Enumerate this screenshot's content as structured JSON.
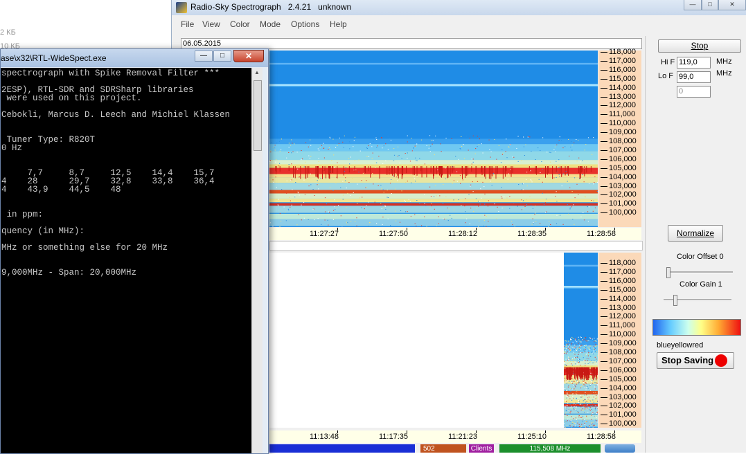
{
  "background": {
    "sizes": [
      "2 КБ",
      "10 КБ"
    ]
  },
  "app": {
    "title": "Radio-Sky Spectrograph",
    "version": "2.4.21",
    "status": "unknown"
  },
  "menu": [
    "File",
    "View",
    "Color",
    "Mode",
    "Options",
    "Help"
  ],
  "date": "06.05.2015",
  "spectrogram_top": {
    "freq_labels": [
      "118,000",
      "117,000",
      "116,000",
      "115,000",
      "114,000",
      "113,000",
      "112,000",
      "111,000",
      "110,000",
      "109,000",
      "108,000",
      "107,000",
      "106,000",
      "105,000",
      "104,000",
      "103,000",
      "102,000",
      "101,000",
      "100,000"
    ],
    "time_labels": [
      "11:27:27",
      "11:27:50",
      "11:28:12",
      "11:28:35",
      "11:28:58"
    ]
  },
  "spectrogram_bottom": {
    "freq_labels": [
      "118,000",
      "117,000",
      "116,000",
      "115,000",
      "114,000",
      "113,000",
      "112,000",
      "111,000",
      "110,000",
      "109,000",
      "108,000",
      "107,000",
      "106,000",
      "105,000",
      "104,000",
      "103,000",
      "102,000",
      "101,000",
      "100,000"
    ],
    "time_labels": [
      "11:13:48",
      "11:17:35",
      "11:21:23",
      "11:25:10",
      "11:28:58"
    ]
  },
  "panel": {
    "stop_label": "Stop",
    "hi_f_label": "Hi F",
    "hi_f_value": "119,0",
    "lo_f_label": "Lo F",
    "lo_f_value": "99,0",
    "unit": "MHz",
    "offset_field": "0",
    "normalize_label": "Normalize",
    "color_offset_label": "Color Offset 0",
    "color_gain_label": "Color Gain 1",
    "palette_name": "blueyellowred",
    "stop_saving_label": "Stop Saving",
    "color_offset_level": 0.05,
    "color_gain_level": 0.15,
    "palette_colors": [
      "#2266ee",
      "#66ccff",
      "#ffff88",
      "#ee1111"
    ]
  },
  "status_bar": {
    "value1": "502",
    "clients": "Clients",
    "frequency": "115,508 MHz"
  },
  "console": {
    "title": "ase\\x32\\RTL-WideSpect.exe",
    "lines": [
      "spectrograph with Spike Removal Filter ***",
      "",
      "2ESP), RTL-SDR and SDRSharp libraries",
      " were used on this project.",
      "",
      "Cebokli, Marcus D. Leech and Michiel Klassen",
      "",
      "",
      " Tuner Type: R820T",
      "0 Hz",
      "",
      "",
      "     7,7     8,7     12,5    14,4    15,7",
      "4    28      29,7    32,8    33,8    36,4",
      "4    43,9    44,5    48",
      "",
      "",
      " in ppm:",
      "",
      "quency (in MHz):",
      "",
      "MHz or something else for 20 MHz",
      "",
      "",
      "9,000MHz - Span: 20,000MHz"
    ]
  }
}
